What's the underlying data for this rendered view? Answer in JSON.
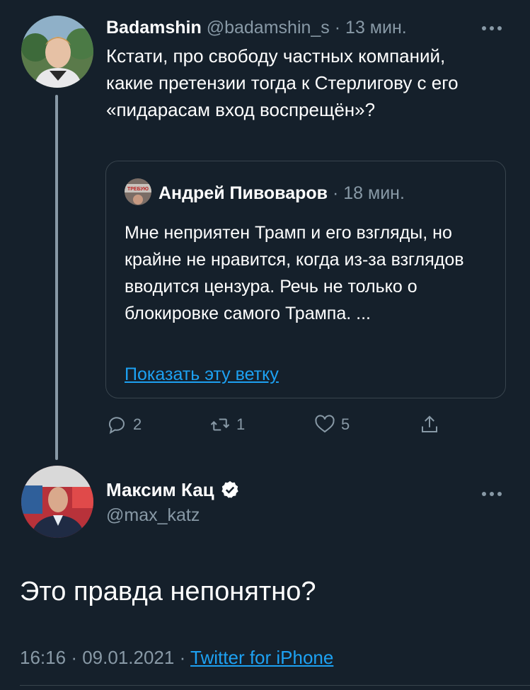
{
  "tweet1": {
    "name": "Badamshin",
    "handle": "@badamshin_s",
    "separator": "·",
    "time": "13 мин.",
    "text": "Кстати, про свободу частных компаний, какие претензии тогда к Стерлигову с его «пидарасам вход воспрещён»?",
    "more_icon": "more-horizontal-icon"
  },
  "quote": {
    "avatar_text": "ТРЕБУЮ СВОБОДЫ",
    "name": "Андрей Пивоваров",
    "separator": "·",
    "time": "18 мин.",
    "text": "Мне неприятен Трамп и его взгляды, но крайне не нравится, когда из-за взглядов вводится цензура. Речь не только о блокировке самого Трампа. ...",
    "link": "Показать эту ветку"
  },
  "actions": {
    "reply_count": "2",
    "retweet_count": "1",
    "like_count": "5",
    "icon_color": "#8899a6"
  },
  "tweet2": {
    "name": "Максим Кац",
    "handle": "@max_katz",
    "text": "Это правда непонятно?",
    "time": "16:16",
    "separator1": "·",
    "date": "09.01.2021",
    "separator2": "·",
    "source": "Twitter for iPhone"
  },
  "colors": {
    "background": "#15202b",
    "muted": "#8899a6",
    "link": "#1da1f2",
    "border": "#38444d"
  }
}
